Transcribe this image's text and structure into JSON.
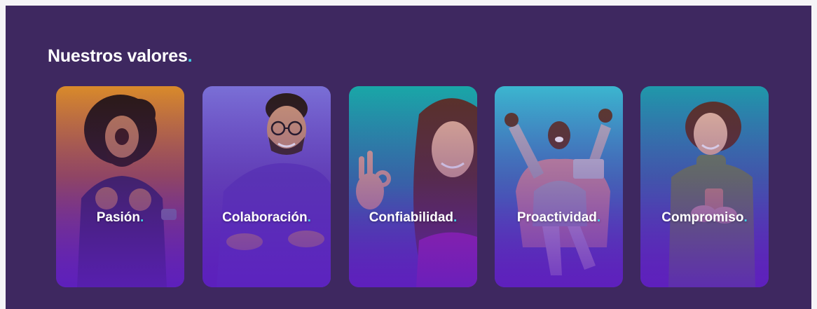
{
  "section": {
    "title": "Nuestros valores",
    "accent_dot": ".",
    "accent_color": "#3fd0e6"
  },
  "cards": [
    {
      "label": "Pasión",
      "dot": "."
    },
    {
      "label": "Colaboración",
      "dot": "."
    },
    {
      "label": "Confiabilidad",
      "dot": "."
    },
    {
      "label": "Proactividad",
      "dot": "."
    },
    {
      "label": "Compromiso",
      "dot": "."
    }
  ]
}
